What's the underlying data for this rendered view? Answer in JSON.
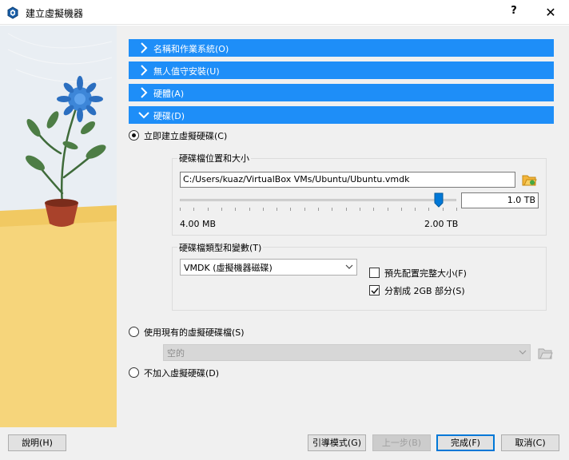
{
  "window": {
    "title": "建立虛擬機器",
    "help_glyph": "?",
    "close_glyph": "✕"
  },
  "sections": [
    {
      "label": "名稱和作業系統(O)",
      "expanded": false
    },
    {
      "label": "無人值守安裝(U)",
      "expanded": false
    },
    {
      "label": "硬體(A)",
      "expanded": false
    },
    {
      "label": "硬碟(D)",
      "expanded": true
    }
  ],
  "disk": {
    "create_now_label": "立即建立虛擬硬碟(C)",
    "create_now_selected": true,
    "location_group_title": "硬碟檔位置和大小",
    "location_path": "C:/Users/kuaz/VirtualBox VMs/Ubuntu/Ubuntu.vmdk",
    "size_value": "1.0 TB",
    "size_slider_fraction": 0.935,
    "size_min_label": "4.00 MB",
    "size_max_label": "2.00 TB",
    "type_group_title": "硬碟檔類型和變數(T)",
    "type_selected": "VMDK (虛擬機器磁碟)",
    "preallocate_label": "預先配置完整大小(F)",
    "preallocate_checked": false,
    "split_label": "分割成 2GB 部分(S)",
    "split_checked": true,
    "use_existing_label": "使用現有的虛擬硬碟檔(S)",
    "use_existing_selected": false,
    "existing_selected": "空的",
    "no_disk_label": "不加入虛擬硬碟(D)",
    "no_disk_selected": false
  },
  "buttons": {
    "help": "說明(H)",
    "guided_mode": "引導模式(G)",
    "back": "上一步(B)",
    "finish": "完成(F)",
    "cancel": "取消(C)"
  },
  "colors": {
    "section_header": "#1e8ef8",
    "accent": "#0078d7"
  }
}
